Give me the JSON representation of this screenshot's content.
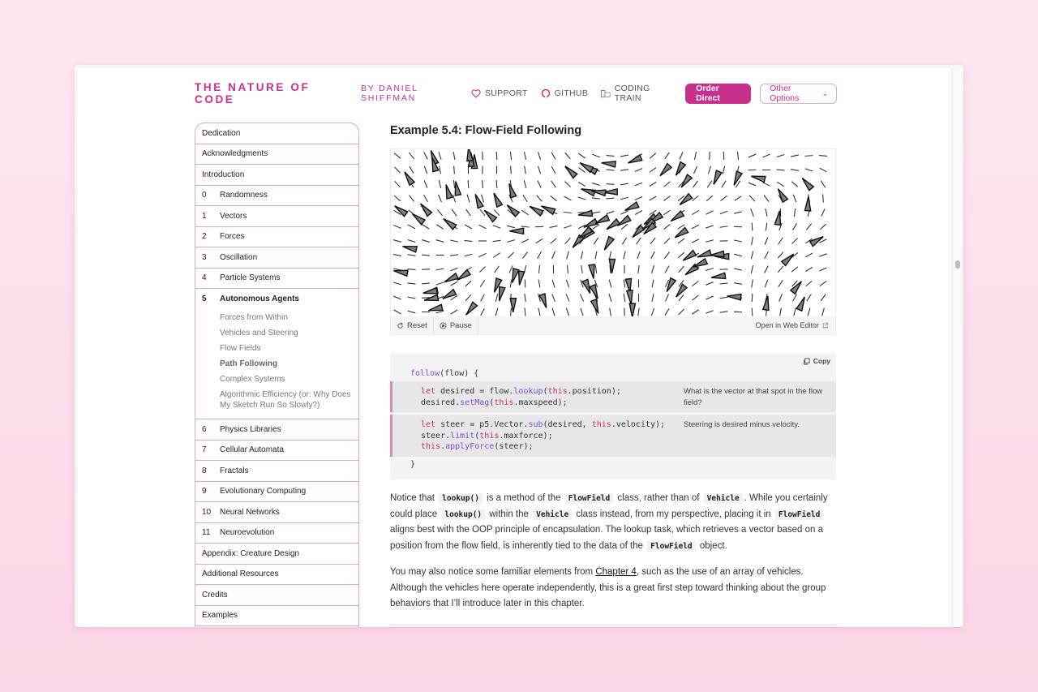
{
  "header": {
    "brand": "THE NATURE OF CODE",
    "byline": "BY DANIEL SHIFFMAN",
    "nav": [
      {
        "label": "SUPPORT",
        "icon": "heart-icon"
      },
      {
        "label": "GITHUB",
        "icon": "github-icon"
      },
      {
        "label": "CODING TRAIN",
        "icon": "coding-train-icon"
      }
    ],
    "order_button": "Order Direct",
    "options_button": "Other Options"
  },
  "toc": {
    "items_top": [
      "Dedication",
      "Acknowledgments",
      "Introduction"
    ],
    "chapters_before": [
      {
        "num": "0",
        "label": "Randomness"
      },
      {
        "num": "1",
        "label": "Vectors"
      },
      {
        "num": "2",
        "label": "Forces"
      },
      {
        "num": "3",
        "label": "Oscillation"
      },
      {
        "num": "4",
        "label": "Particle Systems"
      }
    ],
    "active_chapter": {
      "num": "5",
      "label": "Autonomous Agents"
    },
    "subsections": [
      {
        "label": "Forces from Within",
        "current": false
      },
      {
        "label": "Vehicles and Steering",
        "current": false
      },
      {
        "label": "Flow Fields",
        "current": false
      },
      {
        "label": "Path Following",
        "current": true
      },
      {
        "label": "Complex Systems",
        "current": false
      },
      {
        "label": "Algorithmic Efficiency (or: Why Does My Sketch Run So Slowly?)",
        "current": false
      }
    ],
    "chapters_after": [
      {
        "num": "6",
        "label": "Physics Libraries"
      },
      {
        "num": "7",
        "label": "Cellular Automata"
      },
      {
        "num": "8",
        "label": "Fractals"
      },
      {
        "num": "9",
        "label": "Evolutionary Computing"
      },
      {
        "num": "10",
        "label": "Neural Networks"
      },
      {
        "num": "11",
        "label": "Neuroevolution"
      }
    ],
    "items_bottom": [
      "Appendix: Creature Design",
      "Additional Resources",
      "Credits",
      "Examples"
    ]
  },
  "example": {
    "title": "Example 5.4: Flow-Field Following",
    "controls": {
      "reset": "Reset",
      "pause": "Pause",
      "open_editor": "Open in Web Editor"
    }
  },
  "code": {
    "copy_label": "Copy",
    "lines": {
      "l1a": "follow",
      "l1b": "(flow) {",
      "l2a": "let",
      "l2b": " desired = flow.",
      "l2c": "lookup",
      "l2d": "(",
      "l2e": "this",
      "l2f": ".position);",
      "l3a": "desired.",
      "l3b": "setMag",
      "l3c": "(",
      "l3d": "this",
      "l3e": ".maxspeed);",
      "l4a": "let",
      "l4b": " steer = p5.Vector.",
      "l4c": "sub",
      "l4d": "(desired, ",
      "l4e": "this",
      "l4f": ".velocity);",
      "l5a": "steer.",
      "l5b": "limit",
      "l5c": "(",
      "l5d": "this",
      "l5e": ".maxforce);",
      "l6a": "this",
      "l6b": ".",
      "l6c": "applyForce",
      "l6d": "(steer);",
      "l7": "}"
    },
    "annotations": [
      "What is the vector at that spot in the flow field?",
      "Steering is desired minus velocity."
    ]
  },
  "body": {
    "p1": {
      "t1": "Notice that ",
      "c1": "lookup()",
      "t2": " is a method of the ",
      "c2": "FlowField",
      "t3": " class, rather than of ",
      "c3": "Vehicle",
      "t4": ". While you certainly could place ",
      "c4": "lookup()",
      "t5": " within the ",
      "c5": "Vehicle",
      "t6": " class instead, from my perspective, placing it in ",
      "c6": "FlowField",
      "t7": " aligns best with the OOP principle of encapsulation. The lookup task, which retrieves a vector based on a position from the flow field, is inherently tied to the data of the ",
      "c7": "FlowField",
      "t8": " object."
    },
    "p2": {
      "t1": "You may also notice some familiar elements from ",
      "link": "Chapter 4",
      "t2": ", such as the use of an array of vehicles. Although the vehicles here operate independently, this is a great first step toward thinking about the group behaviors that I’ll introduce later in this chapter."
    }
  },
  "colors": {
    "accent": "#c8308c",
    "border": "#e5a3c9",
    "code_bg": "#f3f3f4",
    "annotation_bg": "#e7e7e9"
  }
}
